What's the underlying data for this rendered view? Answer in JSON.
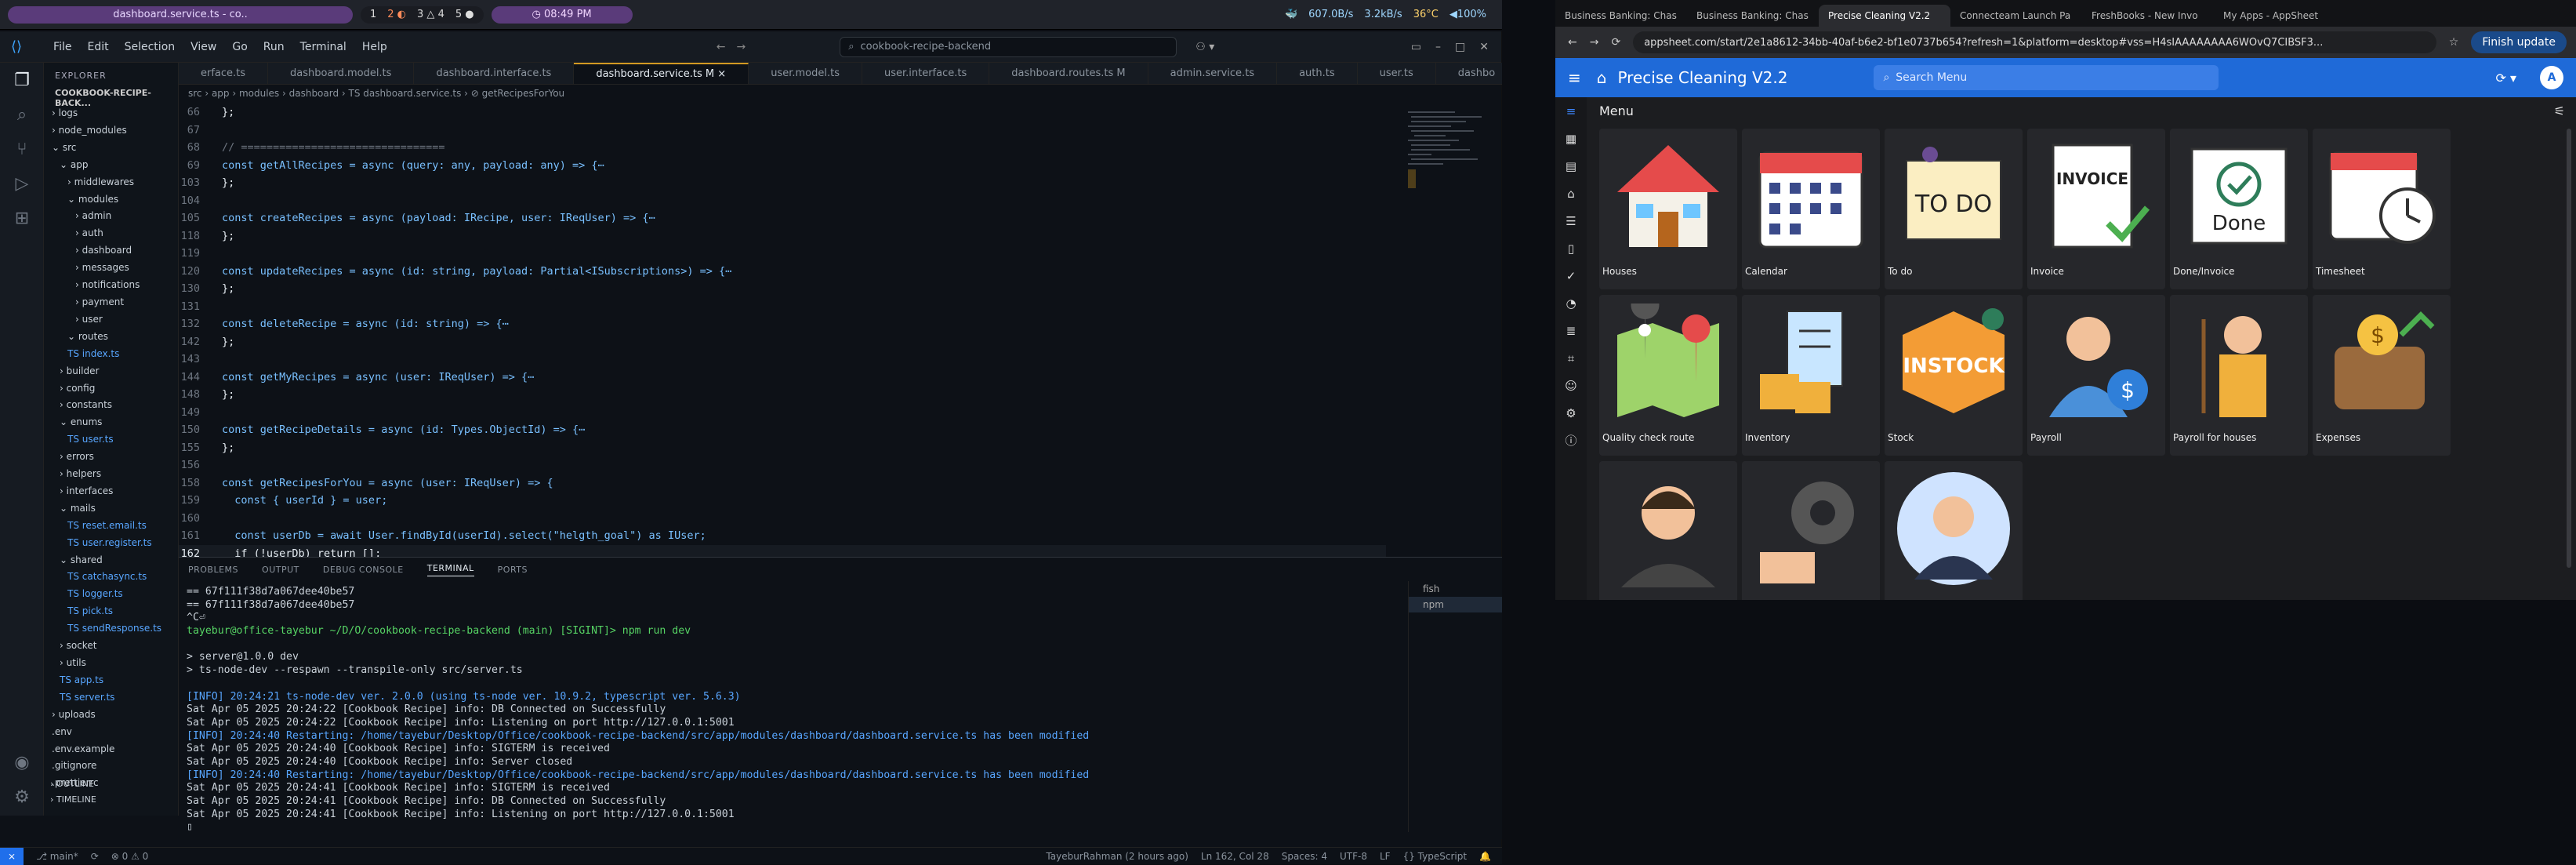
{
  "topbar": {
    "window_title": "dashboard.service.ts - co..",
    "workspaces": [
      "1",
      "2 ◐",
      "3 △ 4",
      "5 ●"
    ],
    "clock": "◷ 08:49 PM",
    "sys": [
      "🐳",
      "607.0B/s",
      "3.2kB/s",
      "36°C",
      "◀100%"
    ]
  },
  "vscode": {
    "menu": [
      "File",
      "Edit",
      "Selection",
      "View",
      "Go",
      "Run",
      "Terminal",
      "Help"
    ],
    "command_center": "cookbook-recipe-backend",
    "activity_icons": [
      "files-icon",
      "search-icon",
      "source-control-icon",
      "run-debug-icon",
      "extensions-icon"
    ],
    "explorer_title": "EXPLORER",
    "project": "COOKBOOK-RECIPE-BACK...",
    "tree": [
      {
        "d": 1,
        "t": "› logs"
      },
      {
        "d": 1,
        "t": "› node_modules"
      },
      {
        "d": 1,
        "t": "⌄ src"
      },
      {
        "d": 2,
        "t": "⌄ app"
      },
      {
        "d": 3,
        "t": "› middlewares"
      },
      {
        "d": 3,
        "t": "⌄ modules"
      },
      {
        "d": 4,
        "t": "› admin"
      },
      {
        "d": 4,
        "t": "› auth"
      },
      {
        "d": 4,
        "t": "› dashboard"
      },
      {
        "d": 4,
        "t": "› messages"
      },
      {
        "d": 4,
        "t": "› notifications"
      },
      {
        "d": 4,
        "t": "› payment"
      },
      {
        "d": 4,
        "t": "› user"
      },
      {
        "d": 3,
        "t": "⌄ routes"
      },
      {
        "d": 3,
        "t": "TS index.ts"
      },
      {
        "d": 2,
        "t": "› builder"
      },
      {
        "d": 2,
        "t": "› config"
      },
      {
        "d": 2,
        "t": "› constants"
      },
      {
        "d": 2,
        "t": "⌄ enums"
      },
      {
        "d": 3,
        "t": "TS user.ts"
      },
      {
        "d": 2,
        "t": "› errors"
      },
      {
        "d": 2,
        "t": "› helpers"
      },
      {
        "d": 2,
        "t": "› interfaces"
      },
      {
        "d": 2,
        "t": "⌄ mails"
      },
      {
        "d": 3,
        "t": "TS reset.email.ts"
      },
      {
        "d": 3,
        "t": "TS user.register.ts"
      },
      {
        "d": 2,
        "t": "⌄ shared"
      },
      {
        "d": 3,
        "t": "TS catchasync.ts"
      },
      {
        "d": 3,
        "t": "TS logger.ts"
      },
      {
        "d": 3,
        "t": "TS pick.ts"
      },
      {
        "d": 3,
        "t": "TS sendResponse.ts"
      },
      {
        "d": 2,
        "t": "› socket"
      },
      {
        "d": 2,
        "t": "› utils"
      },
      {
        "d": 2,
        "t": "TS app.ts"
      },
      {
        "d": 2,
        "t": "TS server.ts"
      },
      {
        "d": 1,
        "t": "› uploads"
      },
      {
        "d": 1,
        "t": ".env"
      },
      {
        "d": 1,
        "t": ".env.example"
      },
      {
        "d": 1,
        "t": ".gitignore"
      },
      {
        "d": 1,
        "t": ".prettierrc"
      }
    ],
    "outline": "› OUTLINE",
    "timeline": "› TIMELINE",
    "tabs": [
      "erface.ts",
      "dashboard.model.ts",
      "dashboard.interface.ts",
      "dashboard.service.ts M ×",
      "user.model.ts",
      "user.interface.ts",
      "dashboard.routes.ts M",
      "admin.service.ts",
      "auth.ts",
      "user.ts",
      "dashbo"
    ],
    "active_tab": 3,
    "breadcrumb": "src › app › modules › dashboard › TS dashboard.service.ts › ⊘ getRecipesForYou",
    "code": [
      {
        "n": "66",
        "t": "};"
      },
      {
        "n": "67",
        "t": ""
      },
      {
        "n": "68",
        "t": "// ================================"
      },
      {
        "n": "69",
        "t": "const getAllRecipes = async (query: any, payload: any) => {⋯"
      },
      {
        "n": "103",
        "t": "};"
      },
      {
        "n": "104",
        "t": ""
      },
      {
        "n": "105",
        "t": "const createRecipes = async (payload: IRecipe, user: IReqUser) => {⋯"
      },
      {
        "n": "118",
        "t": "};"
      },
      {
        "n": "119",
        "t": ""
      },
      {
        "n": "120",
        "t": "const updateRecipes = async (id: string, payload: Partial<ISubscriptions>) => {⋯"
      },
      {
        "n": "130",
        "t": "};"
      },
      {
        "n": "131",
        "t": ""
      },
      {
        "n": "132",
        "t": "const deleteRecipe = async (id: string) => {⋯"
      },
      {
        "n": "142",
        "t": "};"
      },
      {
        "n": "143",
        "t": ""
      },
      {
        "n": "144",
        "t": "const getMyRecipes = async (user: IReqUser) => {⋯"
      },
      {
        "n": "148",
        "t": "};"
      },
      {
        "n": "149",
        "t": ""
      },
      {
        "n": "150",
        "t": "const getRecipeDetails = async (id: Types.ObjectId) => {⋯"
      },
      {
        "n": "155",
        "t": "};"
      },
      {
        "n": "156",
        "t": ""
      },
      {
        "n": "158",
        "t": "const getRecipesForYou = async (user: IReqUser) => {"
      },
      {
        "n": "159",
        "t": "  const { userId } = user;"
      },
      {
        "n": "160",
        "t": ""
      },
      {
        "n": "161",
        "t": "  const userDb = await User.findById(userId).select(\"helgth_goal\") as IUser;"
      },
      {
        "n": "162",
        "t": "  if (!userDb) return [];"
      },
      {
        "n": "163",
        "t": ""
      },
      {
        "n": "164",
        "t": "  const recipes = await Recipe.find({"
      }
    ],
    "current_line": "162",
    "panel_tabs": [
      "PROBLEMS",
      "OUTPUT",
      "DEBUG CONSOLE",
      "TERMINAL",
      "PORTS"
    ],
    "terminal_lines": [
      "== 67f111f38d7a067dee40be57",
      "== 67f111f38d7a067dee40be57",
      "^C⏎",
      "tayebur@office-tayebur ~/D/O/cookbook-recipe-backend (main) [SIGINT]> npm run dev",
      "",
      "> server@1.0.0 dev",
      "> ts-node-dev --respawn --transpile-only src/server.ts",
      "",
      "[INFO] 20:24:21 ts-node-dev ver. 2.0.0 (using ts-node ver. 10.9.2, typescript ver. 5.6.3)",
      "Sat Apr 05 2025 20:24:22 [Cookbook Recipe] info: DB Connected on Successfully",
      "Sat Apr 05 2025 20:24:22 [Cookbook Recipe] info: Listening on port http://127.0.0.1:5001",
      "[INFO] 20:24:40 Restarting: /home/tayebur/Desktop/Office/cookbook-recipe-backend/src/app/modules/dashboard/dashboard.service.ts has been modified",
      "Sat Apr 05 2025 20:24:40 [Cookbook Recipe] info: SIGTERM is received",
      "Sat Apr 05 2025 20:24:40 [Cookbook Recipe] info: Server closed",
      "[INFO] 20:24:40 Restarting: /home/tayebur/Desktop/Office/cookbook-recipe-backend/src/app/modules/dashboard/dashboard.service.ts has been modified",
      "Sat Apr 05 2025 20:24:41 [Cookbook Recipe] info: SIGTERM is received",
      "Sat Apr 05 2025 20:24:41 [Cookbook Recipe] info: DB Connected on Successfully",
      "Sat Apr 05 2025 20:24:41 [Cookbook Recipe] info: Listening on port http://127.0.0.1:5001",
      "▯"
    ],
    "terminals": [
      "fish",
      "npm"
    ],
    "status_left": [
      "⨯",
      "⎇ main*",
      "⟳",
      "⊗ 0 ⚠ 0"
    ],
    "status_right": [
      "TayeburRahman (2 hours ago)",
      "Ln 162, Col 28",
      "Spaces: 4",
      "UTF-8",
      "LF",
      "{} TypeScript",
      "🔔"
    ]
  },
  "browser": {
    "tabs": [
      "Business Banking: Chas",
      "Business Banking: Chas",
      "Precise Cleaning V2.2",
      "Connecteam Launch Pa",
      "FreshBooks - New Invo",
      "My Apps - AppSheet"
    ],
    "active_tab": 2,
    "url": "appsheet.com/start/2e1a8612-34bb-40af-b6e2-bf1e0737b654?refresh=1&platform=desktop#vss=H4sIAAAAAAAA6WOvQ7CIBSF3...",
    "finish_update": "Finish update",
    "app_title": "Precise Cleaning V2.2",
    "search_placeholder": "Search Menu",
    "avatar": "A",
    "menu_title": "Menu",
    "tiles": [
      "Houses",
      "Calendar",
      "To do",
      "Invoice",
      "Done/Invoice",
      "Timesheet",
      "Quality check route",
      "Inventory",
      "Stock",
      "Payroll",
      "Payroll for houses",
      "Expenses",
      "",
      "",
      ""
    ]
  }
}
